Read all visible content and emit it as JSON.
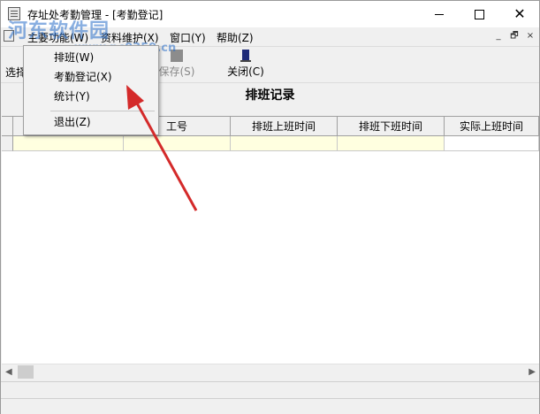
{
  "window": {
    "title": "存址处考勤管理 - [考勤登记]",
    "controls": {
      "minimize": "minimize-icon",
      "maximize": "maximize-icon",
      "close": "close-icon"
    }
  },
  "watermark": {
    "text": "河东软件园",
    "url": "www.pc0359.cn"
  },
  "menubar": {
    "items": [
      {
        "label": "主要功能(W)"
      },
      {
        "label": "资料维护(X)"
      },
      {
        "label": "窗口(Y)"
      },
      {
        "label": "帮助(Z)"
      }
    ],
    "mdi_controls": [
      "_",
      "🗗",
      "×"
    ]
  },
  "toolbar": {
    "select_label": "选择",
    "save_label": "保存(S)",
    "close_label": "关闭(C)"
  },
  "dropdown": {
    "items": [
      {
        "label": "排班(W)"
      },
      {
        "label": "考勤登记(X)"
      },
      {
        "label": "统计(Y)"
      },
      {
        "label": "退出(Z)"
      }
    ]
  },
  "page": {
    "title": "排班记录"
  },
  "grid": {
    "columns": [
      "工号",
      "排班上班时间",
      "排班下班时间",
      "实际上班时间"
    ]
  },
  "colors": {
    "accent_arrow": "#d42a2a",
    "row_highlight": "#ffffe0"
  }
}
